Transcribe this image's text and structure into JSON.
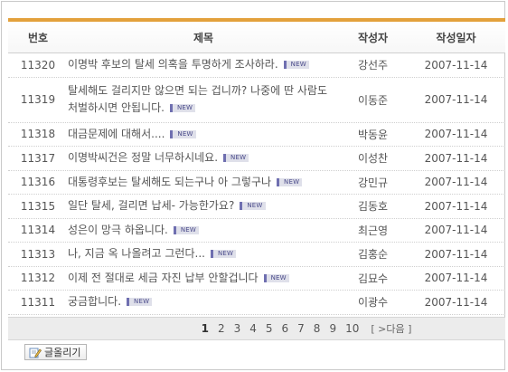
{
  "board": {
    "columns": {
      "no": "번호",
      "title": "제목",
      "author": "작성자",
      "date": "작성일자"
    },
    "new_badge": "NEW",
    "rows": [
      {
        "no": "11320",
        "title": "이명박 후보의 탈세 의혹을 투명하게 조사하라.",
        "author": "강선주",
        "date": "2007-11-14"
      },
      {
        "no": "11319",
        "title": "탈세해도 걸리지만 않으면 되는 겁니까? 나중에 딴 사람도 처벌하시면 안됩니다.",
        "author": "이동준",
        "date": "2007-11-14"
      },
      {
        "no": "11318",
        "title": "대금문제에 대해서....",
        "author": "박동윤",
        "date": "2007-11-14"
      },
      {
        "no": "11317",
        "title": "이명박씨건은 정말 너무하시네요.",
        "author": "이성찬",
        "date": "2007-11-14"
      },
      {
        "no": "11316",
        "title": "대통령후보는 탈세해도 되는구나 아 그렇구나",
        "author": "강민규",
        "date": "2007-11-14"
      },
      {
        "no": "11315",
        "title": "일단 탈세, 걸리면 납세- 가능한가요?",
        "author": "김동호",
        "date": "2007-11-14"
      },
      {
        "no": "11314",
        "title": "성은이 망극 하옵니다.",
        "author": "최근영",
        "date": "2007-11-14"
      },
      {
        "no": "11313",
        "title": "나, 지금 옥 나올려고 그런다...",
        "author": "김홍순",
        "date": "2007-11-14"
      },
      {
        "no": "11312",
        "title": "이제 전 절대로 세금 자진 납부 안할겁니다",
        "author": "김묘수",
        "date": "2007-11-14"
      },
      {
        "no": "11311",
        "title": "궁금합니다.",
        "author": "이광수",
        "date": "2007-11-14"
      }
    ]
  },
  "pagination": {
    "pages": [
      "1",
      "2",
      "3",
      "4",
      "5",
      "6",
      "7",
      "8",
      "9",
      "10"
    ],
    "current": "1",
    "next_label": "[ >다음 ]"
  },
  "write_button": {
    "label": "글올리기",
    "icon": "pencil-write-icon"
  },
  "colors": {
    "accent_bar": "#e3a13c",
    "new_badge_bg": "#dfe0ea",
    "new_badge_edge": "#6f6fb0",
    "pager_bg": "#ececec"
  }
}
